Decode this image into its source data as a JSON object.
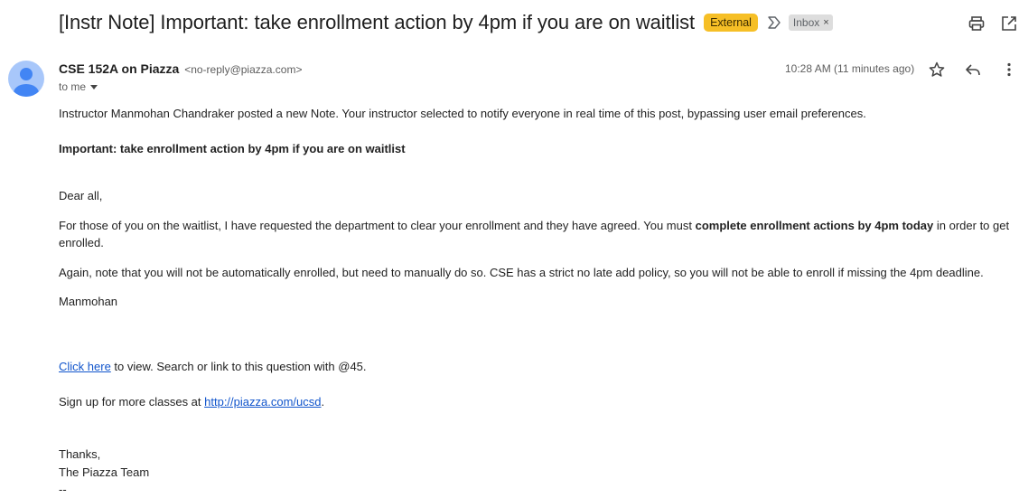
{
  "email": {
    "subject": "[Instr Note] Important: take enrollment action by 4pm if you are on waitlist",
    "external_badge": "External",
    "inbox_label": "Inbox",
    "inbox_label_close": "×",
    "sender_name": "CSE 152A on Piazza",
    "sender_email": "<no-reply@piazza.com>",
    "recipient": "to me",
    "timestamp": "10:28 AM (11 minutes ago)"
  },
  "body": {
    "intro": "Instructor Manmohan Chandraker posted a new Note. Your instructor selected to notify everyone in real time of this post, bypassing user email preferences.",
    "note_title": "Important: take enrollment action by 4pm if you are on waitlist",
    "greeting": "Dear all,",
    "para1_before": "For those of you on the waitlist, I have requested the department to clear your enrollment and they have agreed. You must ",
    "para1_bold": "complete enrollment actions by 4pm today",
    "para1_after": " in order to get enrolled.",
    "para2": "Again, note that you will not be automatically enrolled, but need to manually do so. CSE has a strict no late add policy, so you will not be able to enroll if missing the 4pm deadline.",
    "signature_name": "Manmohan",
    "click_here_link": "Click here",
    "click_here_after": " to view. Search or link to this question with @45.",
    "signup_before": "Sign up for more classes at ",
    "signup_link": "http://piazza.com/ucsd",
    "signup_after": ".",
    "thanks": "Thanks,",
    "team": "The Piazza Team",
    "sig_dashes": "--"
  },
  "icons": {
    "importance": "importance-marker-icon",
    "print": "print-icon",
    "open_new_window": "open-in-new-window-icon",
    "star": "star-icon",
    "reply": "reply-icon",
    "more": "more-vert-icon",
    "avatar": "default-avatar-icon"
  },
  "colors": {
    "external_badge": "#f6bf26",
    "inbox_label_bg": "#dddddd",
    "link": "#1155cc",
    "avatar_bg": "#a8c7fa",
    "avatar_fg": "#4285f4"
  }
}
